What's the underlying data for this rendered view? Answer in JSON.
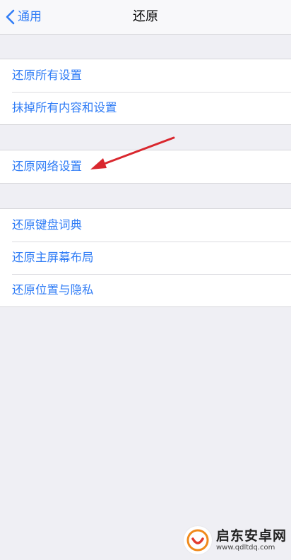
{
  "navbar": {
    "back_label": "通用",
    "title": "还原"
  },
  "groups": [
    {
      "items": [
        {
          "label": "还原所有设置"
        },
        {
          "label": "抹掉所有内容和设置"
        }
      ]
    },
    {
      "items": [
        {
          "label": "还原网络设置"
        }
      ]
    },
    {
      "items": [
        {
          "label": "还原键盘词典"
        },
        {
          "label": "还原主屏幕布局"
        },
        {
          "label": "还原位置与隐私"
        }
      ]
    }
  ],
  "annotation": {
    "color": "#d9272e"
  },
  "watermark": {
    "name": "启东安卓网",
    "url": "www.qdltdq.com"
  },
  "colors": {
    "accent": "#2f7cf6",
    "background": "#efeff4"
  }
}
